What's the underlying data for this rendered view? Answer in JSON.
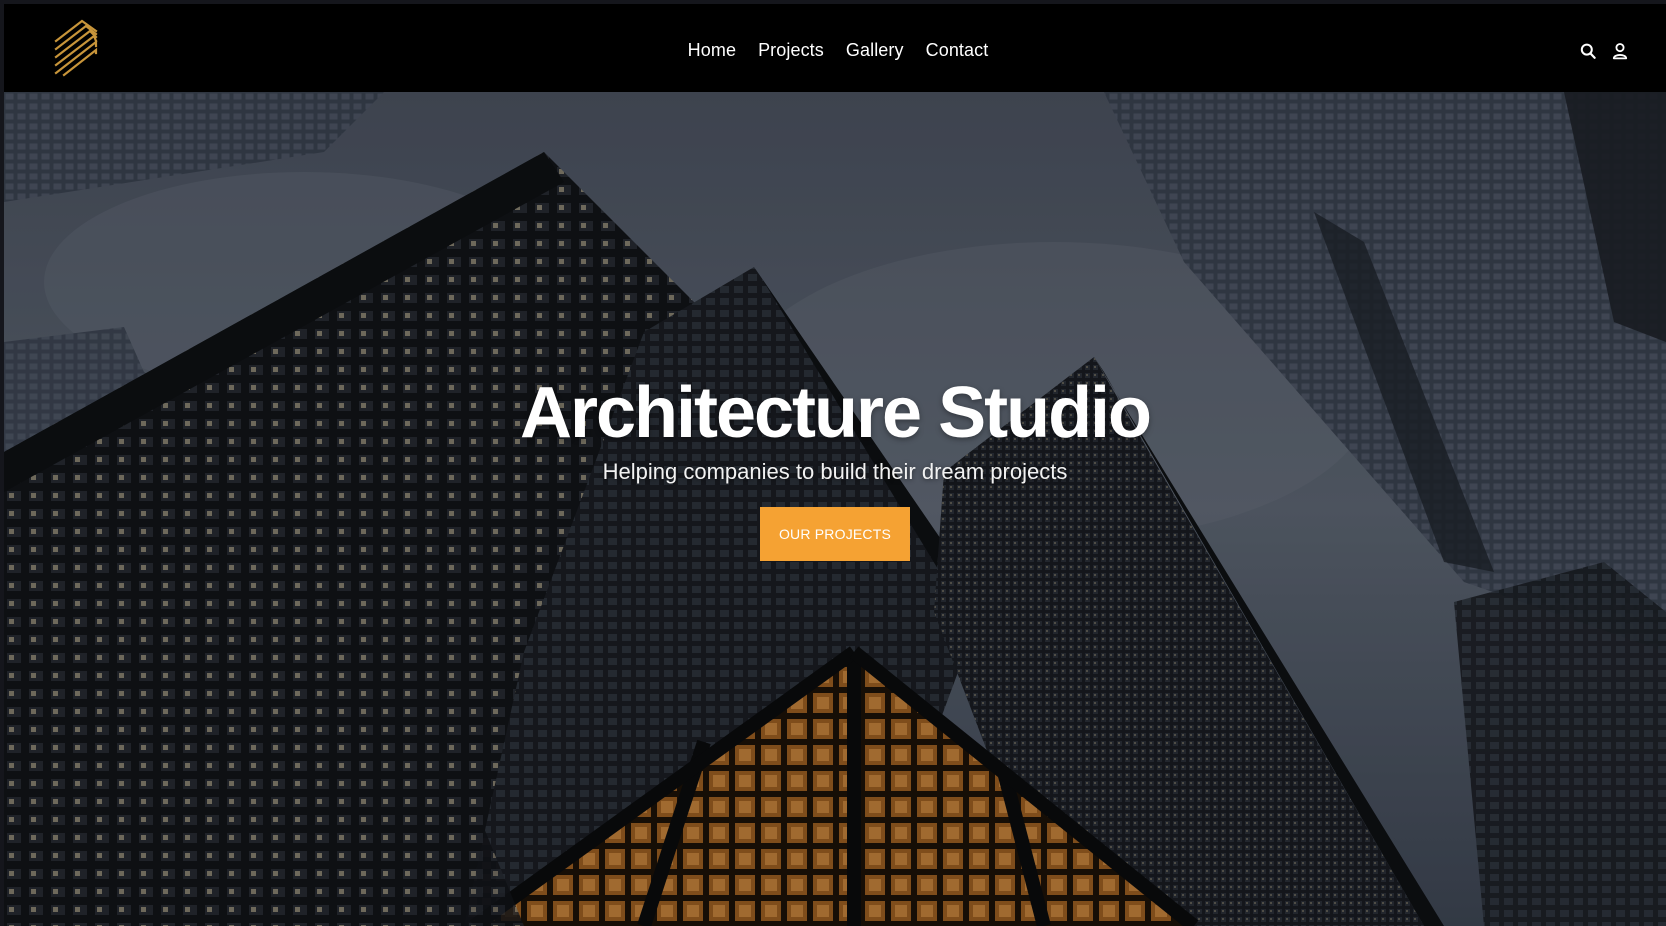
{
  "brand": {
    "logo_icon": "striped-chevron-logo",
    "accent_color": "#c8953a"
  },
  "nav": {
    "items": [
      {
        "label": "Home"
      },
      {
        "label": "Projects"
      },
      {
        "label": "Gallery"
      },
      {
        "label": "Contact"
      }
    ]
  },
  "header_actions": {
    "search_icon": "search-icon",
    "account_icon": "user-icon"
  },
  "hero": {
    "title": "Architecture Studio",
    "subtitle": "Helping companies to build their dream projects",
    "cta_label": "OUR PROJECTS",
    "cta_color": "#f5a233",
    "background": "low-angle photo of glass skyscrapers at dusk"
  }
}
